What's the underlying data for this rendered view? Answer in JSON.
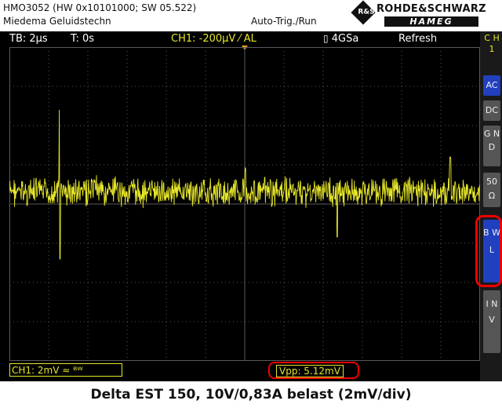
{
  "header": {
    "instrument": "HMO3052 (HW 0x10101000; SW 05.522)",
    "owner": "Miedema Geluidstechn",
    "trigger_mode": "Auto-Trig./Run",
    "brand_line1": "ROHDE&SCHWARZ",
    "brand_line2": "HAMEG",
    "brand_mark": "R&S"
  },
  "status": {
    "timebase": "TB: 2µs",
    "trigger_time": "T: 0s",
    "channel_trigger": "CH1: -200µV ⁄ AL",
    "sample_rate": "4GSa",
    "acq_mode": "Refresh"
  },
  "bottom": {
    "channel_setting": "CH1: 2mV ≈ ᴮᵂ",
    "measurement": "Vpp: 5.12mV"
  },
  "caption": "Delta EST 150, 10V/0,83A belast  (2mV/div)",
  "side_menu": {
    "channel_label": "C H 1",
    "ac": "AC",
    "dc": "DC",
    "gnd": "G N D",
    "ohm": "50 Ω",
    "bwl": "B W L",
    "inv": "I N V"
  },
  "colors": {
    "trace": "#e6e62a",
    "grid": "#5a5a5a",
    "highlight": "#e00000",
    "active_button": "#2040c0"
  }
}
